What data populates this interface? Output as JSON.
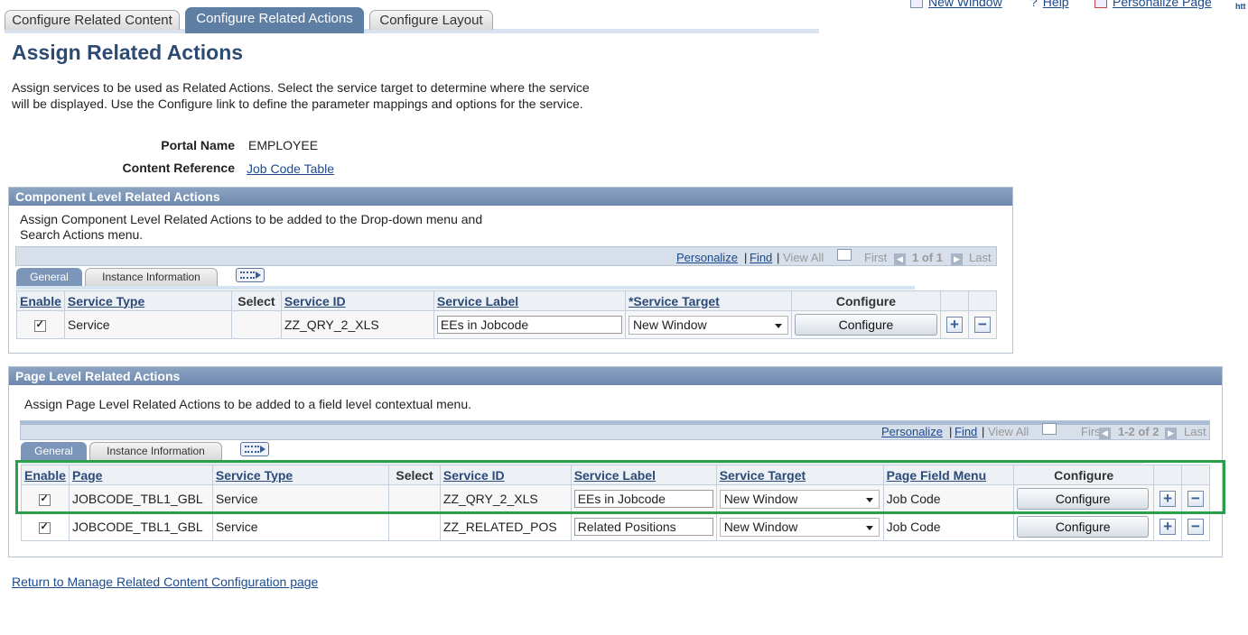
{
  "top_tabs": [
    {
      "label": "Configure Related Content",
      "active": false
    },
    {
      "label": "Configure Related Actions",
      "active": true
    },
    {
      "label": "Configure Layout",
      "active": false
    }
  ],
  "top_links": {
    "new_window": "New Window",
    "help": "Help",
    "personalize": "Personalize Page",
    "http": "htt"
  },
  "page_title": "Assign Related Actions",
  "intro_text": "Assign services to be used as Related Actions. Select the service target to determine where the service will be displayed. Use the Configure link to define the parameter mappings and options for the service.",
  "portal_name": {
    "label": "Portal Name",
    "value": "EMPLOYEE"
  },
  "content_reference": {
    "label": "Content Reference",
    "value": "Job Code Table"
  },
  "component_section": {
    "title": "Component Level Related Actions",
    "description": "Assign Component Level Related Actions to be added to the Drop-down menu and Search Actions menu.",
    "nav": {
      "personalize": "Personalize",
      "find": "Find",
      "view_all": "View All",
      "first": "First",
      "range": "1 of 1",
      "last": "Last"
    },
    "subtabs": [
      "General",
      "Instance Information"
    ],
    "columns": {
      "enable": "Enable",
      "service_type": "Service Type",
      "select": "Select",
      "service_id": "Service ID",
      "service_label": "Service Label",
      "service_target": "*Service Target",
      "configure": "Configure"
    },
    "rows": [
      {
        "enabled": true,
        "service_type": "Service",
        "service_id": "ZZ_QRY_2_XLS",
        "service_label": "EEs in Jobcode",
        "service_target": "New Window",
        "configure": "Configure"
      }
    ]
  },
  "page_section": {
    "title": "Page Level Related Actions",
    "description": "Assign Page Level Related Actions to be added to a field level contextual menu.",
    "nav": {
      "personalize": "Personalize",
      "find": "Find",
      "view_all": "View All",
      "first": "First",
      "range": "1-2 of 2",
      "last": "Last"
    },
    "subtabs": [
      "General",
      "Instance Information"
    ],
    "columns": {
      "enable": "Enable",
      "page": "Page",
      "service_type": "Service Type",
      "select": "Select",
      "service_id": "Service ID",
      "service_label": "Service Label",
      "service_target": "Service Target",
      "page_field_menu": "Page Field Menu",
      "configure": "Configure"
    },
    "rows": [
      {
        "enabled": true,
        "page": "JOBCODE_TBL1_GBL",
        "service_type": "Service",
        "service_id": "ZZ_QRY_2_XLS",
        "service_label": "EEs in Jobcode",
        "service_target": "New Window",
        "page_field_menu": "Job Code",
        "configure": "Configure"
      },
      {
        "enabled": true,
        "page": "JOBCODE_TBL1_GBL",
        "service_type": "Service",
        "service_id": "ZZ_RELATED_POS",
        "service_label": "Related Positions",
        "service_target": "New Window",
        "page_field_menu": "Job Code",
        "configure": "Configure"
      }
    ]
  },
  "footer_link": "Return to Manage Related Content Configuration page",
  "colors": {
    "header_blue": "#2d4a72",
    "tab_active": "#5f7ea3",
    "highlight": "#2aa04a",
    "link": "#1c4a8c"
  }
}
